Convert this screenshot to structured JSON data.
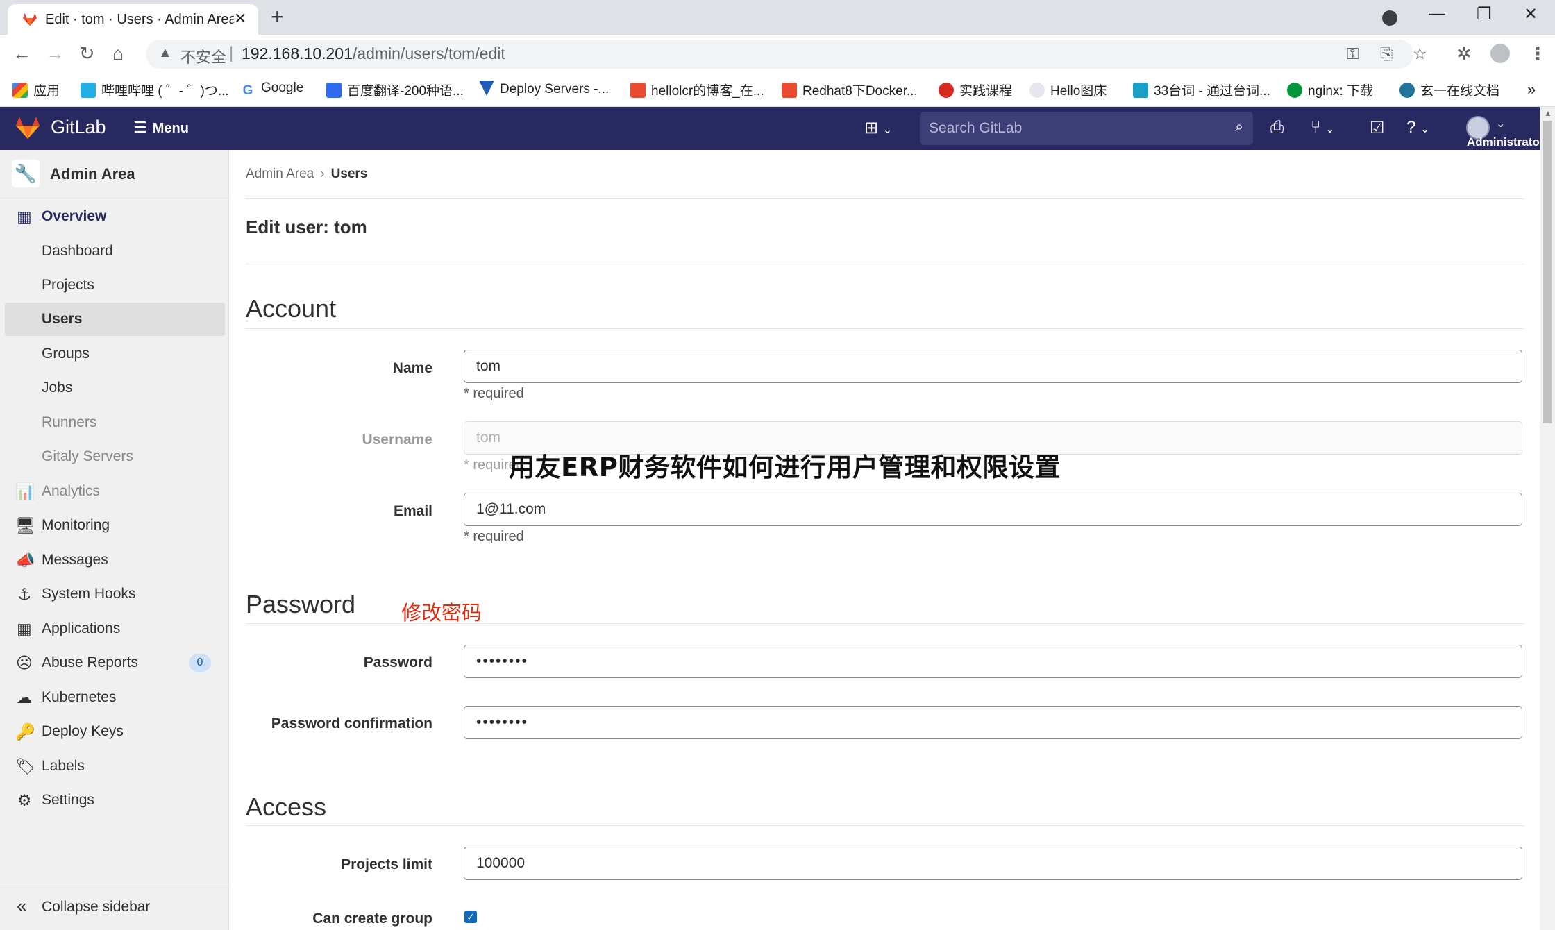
{
  "browser": {
    "tab_title": "Edit · tom · Users · Admin Area",
    "insecure_label": "不安全",
    "url_host": "192.168.10.201",
    "url_path": "/admin/users/tom/edit"
  },
  "bookmarks": [
    {
      "label": "应用",
      "color": "#4285f4"
    },
    {
      "label": "哔哩哔哩 ( ゜- ゜)つ...",
      "color": "#23ade5"
    },
    {
      "label": "Google",
      "color": "#ea4335"
    },
    {
      "label": "百度翻译-200种语...",
      "color": "#2e6bf0"
    },
    {
      "label": "Deploy Servers -...",
      "color": "#1f5bb7"
    },
    {
      "label": "hellolcr的博客_在...",
      "color": "#e94c30"
    },
    {
      "label": "Redhat8下Docker...",
      "color": "#e94c30"
    },
    {
      "label": "实践课程",
      "color": "#d72b1f"
    },
    {
      "label": "Hello图床",
      "color": "#6b6b8f"
    },
    {
      "label": "33台词 - 通过台词...",
      "color": "#19a0c8"
    },
    {
      "label": "nginx: 下载",
      "color": "#009639"
    },
    {
      "label": "玄一在线文档",
      "color": "#21759b"
    }
  ],
  "gitlab": {
    "brand": "GitLab",
    "menu_label": "Menu",
    "search_placeholder": "Search GitLab",
    "user_label": "Administrato"
  },
  "sidebar": {
    "context": "Admin Area",
    "items": [
      {
        "label": "Overview",
        "icon": "overview-icon"
      },
      {
        "label": "Dashboard"
      },
      {
        "label": "Projects"
      },
      {
        "label": "Users"
      },
      {
        "label": "Groups"
      },
      {
        "label": "Jobs"
      },
      {
        "label": "Runners"
      },
      {
        "label": "Gitaly Servers"
      },
      {
        "label": "Analytics",
        "icon": "analytics-icon"
      },
      {
        "label": "Monitoring",
        "icon": "monitoring-icon"
      },
      {
        "label": "Messages",
        "icon": "messages-icon"
      },
      {
        "label": "System Hooks",
        "icon": "hook-icon"
      },
      {
        "label": "Applications",
        "icon": "applications-icon"
      },
      {
        "label": "Abuse Reports",
        "icon": "abuse-icon",
        "badge": "0"
      },
      {
        "label": "Kubernetes",
        "icon": "kubernetes-icon"
      },
      {
        "label": "Deploy Keys",
        "icon": "key-icon"
      },
      {
        "label": "Labels",
        "icon": "label-icon"
      },
      {
        "label": "Settings",
        "icon": "settings-icon"
      }
    ],
    "collapse_label": "Collapse sidebar"
  },
  "breadcrumb": {
    "parent": "Admin Area",
    "current": "Users"
  },
  "page_title": "Edit user: tom",
  "sections": {
    "account": "Account",
    "password": "Password",
    "access": "Access"
  },
  "annotation": "修改密码",
  "form": {
    "name": {
      "label": "Name",
      "value": "tom",
      "hint": "* required"
    },
    "username": {
      "label": "Username",
      "value": "tom",
      "hint": "* required"
    },
    "email": {
      "label": "Email",
      "value": "1@11.com",
      "hint": "* required"
    },
    "password": {
      "label": "Password",
      "value": "••••••••"
    },
    "password_confirmation": {
      "label": "Password confirmation",
      "value": "••••••••"
    },
    "projects_limit": {
      "label": "Projects limit",
      "value": "100000"
    },
    "can_create_group": {
      "label": "Can create group",
      "checked": true
    }
  },
  "overlay_text": "用友ERP财务软件如何进行用户管理和权限设置",
  "colors": {
    "gitlab_header": "#292961",
    "annotation": "#dd2b0e",
    "checkbox": "#1068bf"
  }
}
